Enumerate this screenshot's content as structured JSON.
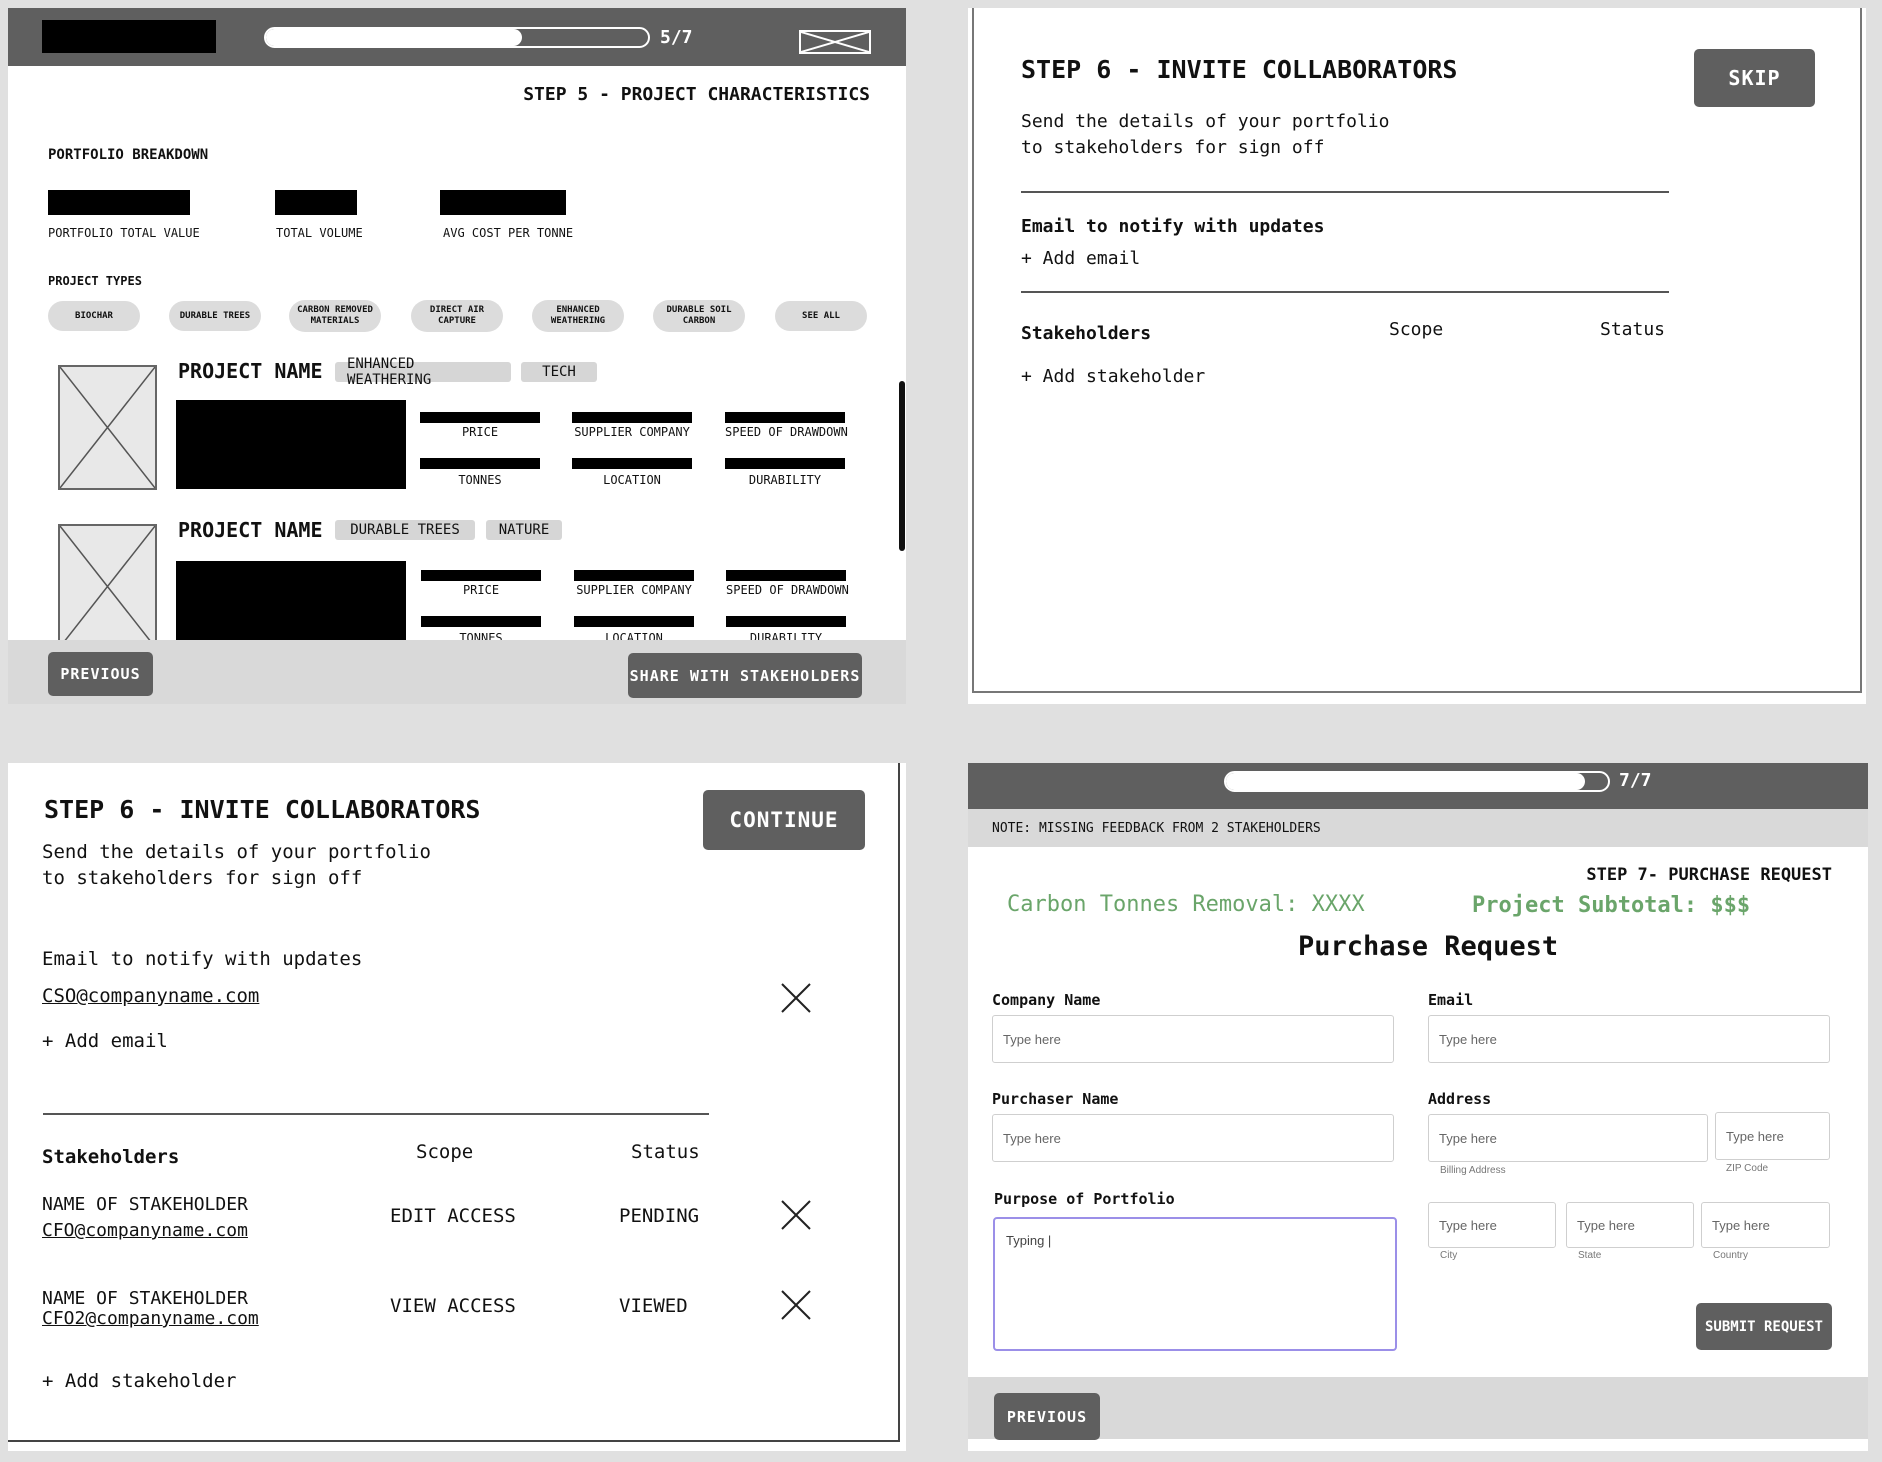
{
  "step5": {
    "progress_text": "5/7",
    "progress_fraction": 0.67,
    "title": "STEP 5 - PROJECT CHARACTERISTICS",
    "breakdown_title": "PORTFOLIO BREAKDOWN",
    "metrics": [
      "PORTFOLIO TOTAL VALUE",
      "TOTAL VOLUME",
      "AVG COST PER TONNE"
    ],
    "project_types_title": "PROJECT TYPES",
    "chips": [
      "BIOCHAR",
      "DURABLE TREES",
      "CARBON REMOVED MATERIALS",
      "DIRECT AIR CAPTURE",
      "ENHANCED WEATHERING",
      "DURABLE SOIL CARBON",
      "SEE ALL"
    ],
    "projects": [
      {
        "name": "PROJECT NAME",
        "tags": [
          "ENHANCED WEATHERING",
          "TECH"
        ]
      },
      {
        "name": "PROJECT NAME",
        "tags": [
          "DURABLE TREES",
          "NATURE"
        ]
      }
    ],
    "attr_labels": [
      "PRICE",
      "SUPPLIER COMPANY",
      "SPEED OF DRAWDOWN",
      "TONNES",
      "LOCATION",
      "DURABILITY"
    ],
    "previous_label": "PREVIOUS",
    "share_label": "SHARE WITH STAKEHOLDERS"
  },
  "step6a": {
    "title": "STEP 6 - INVITE COLLABORATORS",
    "skip_label": "SKIP",
    "desc_line1": "Send the details of your portfolio",
    "desc_line2": "to stakeholders for sign off",
    "email_heading": "Email to notify with updates",
    "add_email": "+ Add email",
    "col_stakeholders": "Stakeholders",
    "col_scope": "Scope",
    "col_status": "Status",
    "add_stakeholder": "+ Add stakeholder"
  },
  "step6b": {
    "title": "STEP 6 - INVITE COLLABORATORS",
    "continue_label": "CONTINUE",
    "desc_line1": "Send the details of your portfolio",
    "desc_line2": "to stakeholders for sign off",
    "email_heading": "Email to notify with updates",
    "email_value": "CSO@companyname.com",
    "add_email": "+ Add email",
    "col_stakeholders": "Stakeholders",
    "col_scope": "Scope",
    "col_status": "Status",
    "rows": [
      {
        "name": "NAME OF STAKEHOLDER",
        "email": "CFO@companyname.com",
        "scope": "EDIT ACCESS",
        "status": "PENDING"
      },
      {
        "name": "NAME OF STAKEHOLDER",
        "email": "CFO2@companyname.com",
        "scope": "VIEW ACCESS",
        "status": "VIEWED"
      }
    ],
    "add_stakeholder": "+ Add stakeholder"
  },
  "step7": {
    "progress_text": "7/7",
    "progress_fraction": 0.94,
    "note": "NOTE: MISSING FEEDBACK FROM 2 STAKEHOLDERS",
    "title": "STEP 7- PURCHASE REQUEST",
    "carbon": "Carbon Tonnes Removal: XXXX",
    "subtotal": "Project Subtotal: $$$",
    "form_title": "Purchase Request",
    "company_label": "Company Name",
    "email_label": "Email",
    "purchaser_label": "Purchaser Name",
    "address_label": "Address",
    "purpose_label": "Purpose of Portfolio",
    "placeholder": "Type here",
    "purpose_value": "Typing |",
    "billing_sub": "Billing Address",
    "zip_sub": "ZIP Code",
    "city_sub": "City",
    "state_sub": "State",
    "country_sub": "Country",
    "submit_label": "SUBMIT REQUEST",
    "previous_label": "PREVIOUS"
  },
  "colors": {
    "accent_green": "#6aa56a",
    "button_gray": "#5f5f5f",
    "focus_purple": "#9b8fe8"
  }
}
